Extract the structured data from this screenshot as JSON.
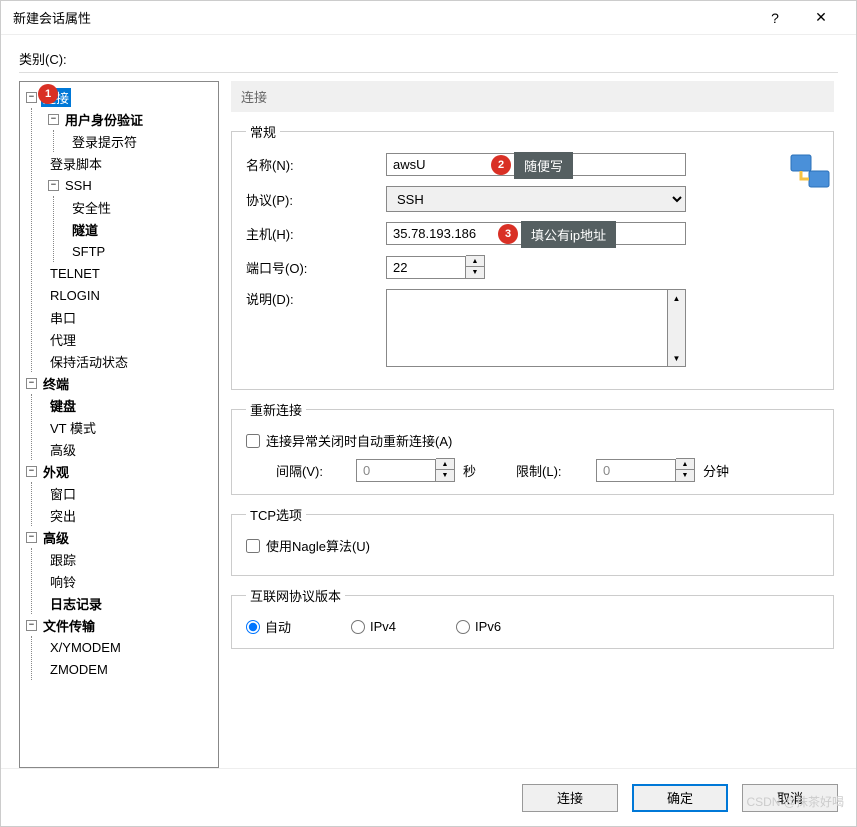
{
  "titlebar": {
    "title": "新建会话属性",
    "help": "?",
    "close": "✕"
  },
  "category_label": "类别(C):",
  "tree": {
    "connection": "连接",
    "auth": "用户身份验证",
    "login_prompt": "登录提示符",
    "login_script": "登录脚本",
    "ssh": "SSH",
    "security": "安全性",
    "tunnel": "隧道",
    "sftp": "SFTP",
    "telnet": "TELNET",
    "rlogin": "RLOGIN",
    "serial": "串口",
    "proxy": "代理",
    "keepalive": "保持活动状态",
    "terminal": "终端",
    "keyboard": "键盘",
    "vt": "VT 模式",
    "advanced_t": "高级",
    "appearance": "外观",
    "window": "窗口",
    "highlight": "突出",
    "advanced": "高级",
    "trace": "跟踪",
    "bell": "响铃",
    "logging": "日志记录",
    "file_transfer": "文件传输",
    "xymodem": "X/YMODEM",
    "zmodem": "ZMODEM"
  },
  "header_strip": "连接",
  "general": {
    "legend": "常规",
    "name_label": "名称(N):",
    "name_value": "awsU",
    "protocol_label": "协议(P):",
    "protocol_value": "SSH",
    "host_label": "主机(H):",
    "host_value": "35.78.193.186",
    "port_label": "端口号(O):",
    "port_value": "22",
    "desc_label": "说明(D):"
  },
  "reconnect": {
    "legend": "重新连接",
    "checkbox": "连接异常关闭时自动重新连接(A)",
    "interval_label": "间隔(V):",
    "interval_value": "0",
    "interval_unit": "秒",
    "limit_label": "限制(L):",
    "limit_value": "0",
    "limit_unit": "分钟"
  },
  "tcp": {
    "legend": "TCP选项",
    "nagle": "使用Nagle算法(U)"
  },
  "ip": {
    "legend": "互联网协议版本",
    "auto": "自动",
    "ipv4": "IPv4",
    "ipv6": "IPv6"
  },
  "buttons": {
    "connect": "连接",
    "ok": "确定",
    "cancel": "取消"
  },
  "badges": {
    "b1": "1",
    "b2": "2",
    "b3": "3",
    "tip2": "随便写",
    "tip3": "填公有ip地址"
  },
  "watermark": "CSDN @抹茶好喝"
}
